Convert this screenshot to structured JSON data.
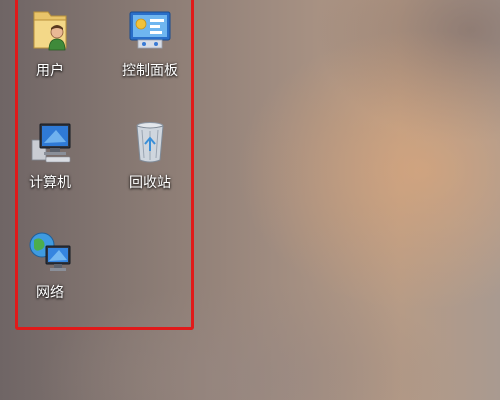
{
  "desktop": {
    "icons": [
      {
        "id": "user",
        "label": "用户",
        "icon": "user-folder-icon"
      },
      {
        "id": "control_panel",
        "label": "控制面板",
        "icon": "control-panel-icon"
      },
      {
        "id": "computer",
        "label": "计算机",
        "icon": "computer-icon"
      },
      {
        "id": "recycle_bin",
        "label": "回收站",
        "icon": "recycle-bin-icon"
      },
      {
        "id": "network",
        "label": "网络",
        "icon": "network-icon"
      }
    ]
  },
  "colors": {
    "selection_outline": "#e01a1a",
    "label_text": "#ffffff"
  }
}
